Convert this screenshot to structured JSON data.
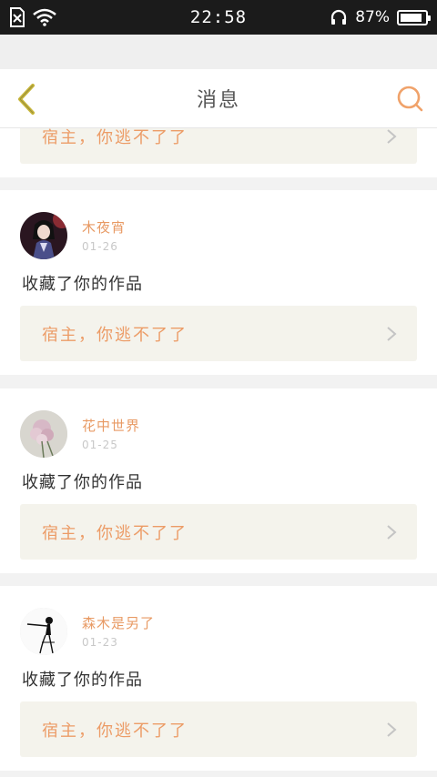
{
  "status_bar": {
    "time": "22:58",
    "battery_percent": "87%",
    "battery_level": 0.87,
    "icons": [
      "sim-card-icon",
      "wifi-icon",
      "headphones-icon",
      "battery-icon"
    ]
  },
  "header": {
    "title": "消息",
    "back_icon": "chevron-left-icon",
    "search_icon": "search-icon",
    "accent_color": "#f0a26a",
    "back_color": "#c7b63a"
  },
  "top_partial_card": {
    "quote": "宿主，你逃不了了"
  },
  "messages": [
    {
      "user_name": "木夜宵",
      "date": "01-26",
      "text": "收藏了你的作品",
      "quote": "宿主，你逃不了了",
      "avatar": "anime-character-avatar"
    },
    {
      "user_name": "花中世界",
      "date": "01-25",
      "text": "收藏了你的作品",
      "quote": "宿主，你逃不了了",
      "avatar": "flower-avatar"
    },
    {
      "user_name": "森木是另了",
      "date": "01-23",
      "text": "收藏了你的作品",
      "quote": "宿主，你逃不了了",
      "avatar": "dancer-avatar"
    }
  ]
}
